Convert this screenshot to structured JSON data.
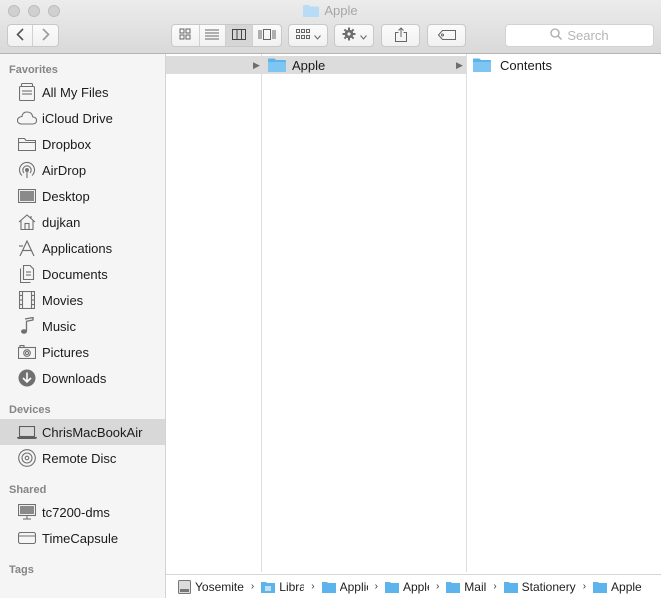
{
  "window": {
    "title": "Apple"
  },
  "toolbar": {
    "back_icon": "chevron-left-icon",
    "forward_icon": "chevron-right-icon",
    "view_modes": [
      "icon-view",
      "list-view",
      "column-view",
      "cover-flow-view"
    ],
    "active_view": "column-view",
    "search_placeholder": "Search"
  },
  "sidebar": {
    "sections": [
      {
        "heading": "Favorites",
        "items": [
          {
            "label": "All My Files",
            "icon": "all-files-icon"
          },
          {
            "label": "iCloud Drive",
            "icon": "cloud-icon"
          },
          {
            "label": "Dropbox",
            "icon": "folder-icon"
          },
          {
            "label": "AirDrop",
            "icon": "airdrop-icon"
          },
          {
            "label": "Desktop",
            "icon": "desktop-icon"
          },
          {
            "label": "dujkan",
            "icon": "home-icon"
          },
          {
            "label": "Applications",
            "icon": "applications-icon"
          },
          {
            "label": "Documents",
            "icon": "documents-icon"
          },
          {
            "label": "Movies",
            "icon": "movies-icon"
          },
          {
            "label": "Music",
            "icon": "music-icon"
          },
          {
            "label": "Pictures",
            "icon": "camera-icon"
          },
          {
            "label": "Downloads",
            "icon": "download-icon"
          }
        ]
      },
      {
        "heading": "Devices",
        "items": [
          {
            "label": "ChrisMacBookAir",
            "icon": "laptop-icon",
            "selected": true
          },
          {
            "label": "Remote Disc",
            "icon": "disc-icon"
          }
        ]
      },
      {
        "heading": "Shared",
        "items": [
          {
            "label": "tc7200-dms",
            "icon": "monitor-icon"
          },
          {
            "label": "TimeCapsule",
            "icon": "time-capsule-icon"
          }
        ]
      },
      {
        "heading": "Tags",
        "items": []
      }
    ]
  },
  "columns": {
    "col2": {
      "name": "Apple"
    },
    "col3": {
      "name": "Contents"
    }
  },
  "pathbar": {
    "crumbs": [
      "Yosemite",
      "Library",
      "Application Support",
      "Apple",
      "Mail",
      "Stationery",
      "Apple"
    ]
  },
  "colors": {
    "folder": "#5db3ec",
    "selection": "#dcdcdc"
  }
}
